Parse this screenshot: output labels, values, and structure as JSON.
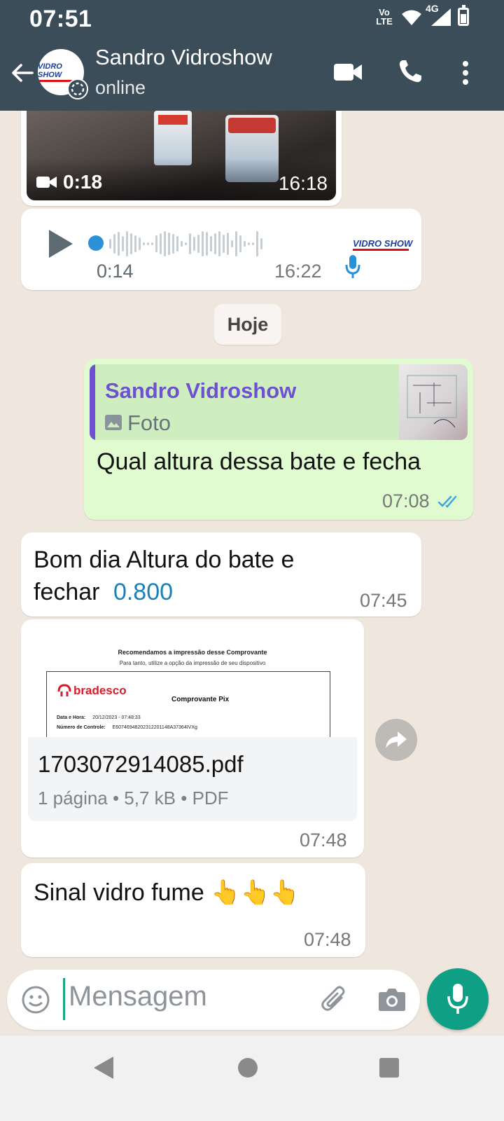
{
  "status_bar": {
    "time": "07:51",
    "volte": "Vo LTE",
    "network": "4G"
  },
  "header": {
    "contact_name": "Sandro Vidroshow",
    "contact_status": "online",
    "avatar_logo_text": "VIDRO SHOW"
  },
  "messages": {
    "video": {
      "duration": "0:18",
      "time": "16:18"
    },
    "audio": {
      "elapsed": "0:14",
      "time": "16:22",
      "sender_logo": "VIDRO SHOW"
    },
    "date_divider": "Hoje",
    "reply": {
      "quoted_sender": "Sandro Vidroshow",
      "quoted_type": "Foto",
      "text": "Qual altura dessa bate e fecha",
      "time": "07:08"
    },
    "incoming_text": {
      "text": "Bom dia Altura do bate e fechar",
      "highlight": "0.800",
      "time": "07:45"
    },
    "document": {
      "preview_heading": "Recomendamos a impressão desse Comprovante",
      "preview_sub": "Para tanto, utilize a opção da impressão de seu dispositivo",
      "preview_bank": "bradesco",
      "preview_title": "Comprovante Pix",
      "preview_date_label": "Data e Hora:",
      "preview_date_value": "20/12/2023 - 07:48:33",
      "preview_control_label": "Número de Controle:",
      "preview_control_value": "E60746948202312201148A37364IVXg",
      "filename": "1703072914085.pdf",
      "meta": "1 página • 5,7 kB • PDF",
      "time": "07:48"
    },
    "last": {
      "text": "Sinal vidro fume 👆👆👆",
      "time": "07:48"
    }
  },
  "composer": {
    "placeholder": "Mensagem"
  },
  "colors": {
    "header_bg": "#3b4d59",
    "chat_bg": "#efe7de",
    "outgoing_bubble": "#e1fbd0",
    "accent_green": "#0f9f84",
    "link_blue": "#1a80b6",
    "read_ticks": "#35a4e0"
  },
  "icons": [
    "back-arrow-icon",
    "video-call-icon",
    "phone-icon",
    "more-vert-icon",
    "play-icon",
    "mic-icon",
    "image-icon",
    "read-ticks-icon",
    "forward-icon",
    "emoji-icon",
    "attach-icon",
    "camera-icon",
    "nav-back-icon",
    "nav-home-icon",
    "nav-recents-icon"
  ]
}
